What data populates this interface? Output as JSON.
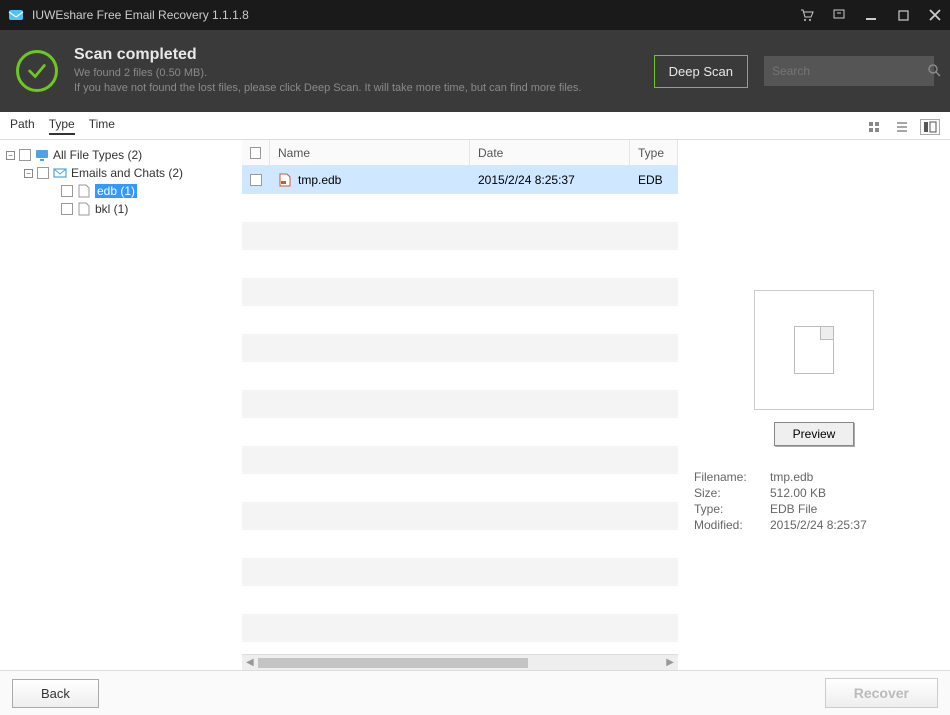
{
  "window": {
    "title": "IUWEshare Free Email Recovery 1.1.1.8"
  },
  "header": {
    "title": "Scan completed",
    "line1": "We found 2 files (0.50 MB).",
    "line2": "If you have not found the lost files, please click Deep Scan. It will take more time, but can find more files.",
    "deep_scan": "Deep Scan",
    "search_placeholder": "Search"
  },
  "tabs": {
    "path": "Path",
    "type": "Type",
    "time": "Time"
  },
  "tree": {
    "root": {
      "label": "All File Types (2)"
    },
    "group": {
      "label": "Emails and Chats (2)"
    },
    "leaf1": {
      "label": "edb (1)"
    },
    "leaf2": {
      "label": "bkl (1)"
    }
  },
  "columns": {
    "name": "Name",
    "date": "Date",
    "type": "Type"
  },
  "files": [
    {
      "name": "tmp.edb",
      "date": "2015/2/24 8:25:37",
      "type": "EDB"
    }
  ],
  "preview": {
    "button": "Preview",
    "labels": {
      "filename": "Filename:",
      "size": "Size:",
      "type": "Type:",
      "modified": "Modified:"
    },
    "values": {
      "filename": "tmp.edb",
      "size": "512.00 KB",
      "type": "EDB File",
      "modified": "2015/2/24 8:25:37"
    }
  },
  "footer": {
    "back": "Back",
    "recover": "Recover"
  }
}
